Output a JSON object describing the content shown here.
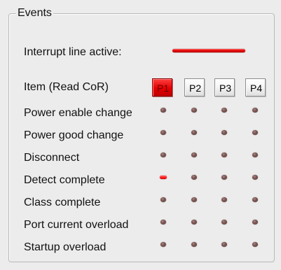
{
  "events": {
    "title": "Events",
    "interrupt_label": "Interrupt line active:",
    "interrupt_active": true,
    "item_label": "Item (Read CoR)",
    "ports": [
      {
        "label": "P1",
        "selected": true
      },
      {
        "label": "P2",
        "selected": false
      },
      {
        "label": "P3",
        "selected": false
      },
      {
        "label": "P4",
        "selected": false
      }
    ],
    "rows": [
      {
        "label": "Power enable change",
        "states": [
          false,
          false,
          false,
          false
        ]
      },
      {
        "label": "Power good change",
        "states": [
          false,
          false,
          false,
          false
        ]
      },
      {
        "label": "Disconnect",
        "states": [
          false,
          false,
          false,
          false
        ]
      },
      {
        "label": "Detect complete",
        "states": [
          true,
          false,
          false,
          false
        ]
      },
      {
        "label": "Class complete",
        "states": [
          false,
          false,
          false,
          false
        ]
      },
      {
        "label": "Port current overload",
        "states": [
          false,
          false,
          false,
          false
        ]
      },
      {
        "label": "Startup overload",
        "states": [
          false,
          false,
          false,
          false
        ]
      }
    ],
    "colors": {
      "active_red": "#e50000",
      "inactive_led": "#6b4a47",
      "panel_background": "#ececec"
    }
  }
}
